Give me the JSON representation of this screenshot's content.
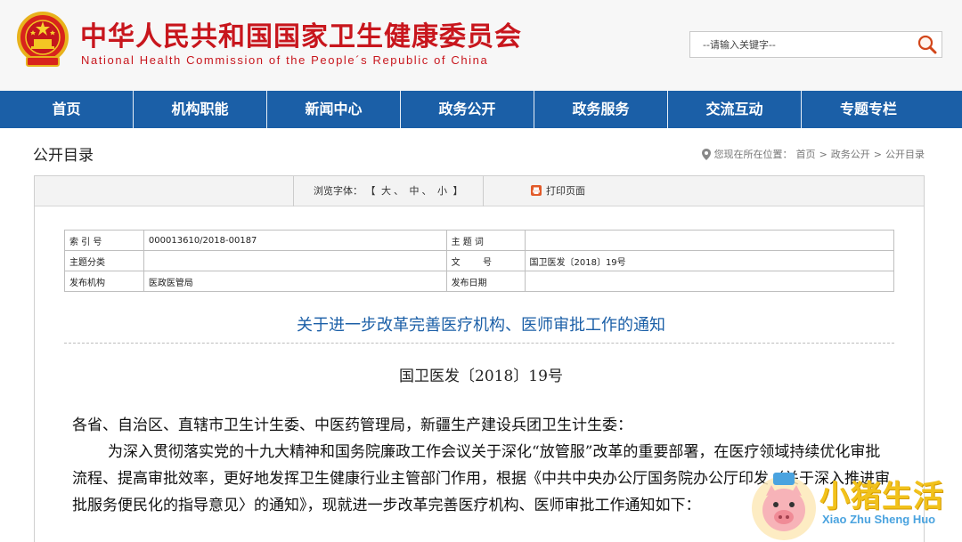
{
  "header": {
    "site_name_cn": "中华人民共和国国家卫生健康委员会",
    "site_name_en": "National Health Commission of the People´s Republic of China",
    "search_placeholder": "--请输入关键字--"
  },
  "nav": {
    "items": [
      "首页",
      "机构职能",
      "新闻中心",
      "政务公开",
      "政务服务",
      "交流互动",
      "专题专栏"
    ]
  },
  "section": {
    "title": "公开目录",
    "breadcrumb_prefix": "您现在所在位置：",
    "breadcrumb": [
      "首页",
      "政务公开",
      "公开目录"
    ],
    "breadcrumb_sep": ">"
  },
  "toolbar": {
    "font_label": "浏览字体：",
    "bracket_open": "【",
    "bracket_close": "】",
    "sizes": [
      "大",
      "中",
      "小"
    ],
    "size_sep": "、",
    "print_label": "打印页面"
  },
  "meta": {
    "rows": [
      {
        "k1": "索 引 号",
        "v1": "000013610/2018-00187",
        "k2": "主 题 词",
        "v2": ""
      },
      {
        "k1": "主题分类",
        "v1": "",
        "k2": "文        号",
        "v2": "国卫医发〔2018〕19号"
      },
      {
        "k1": "发布机构",
        "v1": "医政医管局",
        "k2": "发布日期",
        "v2": ""
      }
    ]
  },
  "document": {
    "title": "关于进一步改革完善医疗机构、医师审批工作的通知",
    "number": "国卫医发〔2018〕19号",
    "salutation": "各省、自治区、直辖市卫生计生委、中医药管理局，新疆生产建设兵团卫生计生委：",
    "paragraph": "为深入贯彻落实党的十九大精神和国务院廉政工作会议关于深化“放管服”改革的重要部署，在医疗领域持续优化审批流程、提高审批效率，更好地发挥卫生健康行业主管部门作用，根据《中共中央办公厅国务院办公厅印发〈关于深入推进审批服务便民化的指导意见〉的通知》，现就进一步改革完善医疗机构、医师审批工作通知如下："
  },
  "watermark": {
    "text_cn": "小猪生活",
    "text_en": "Xiao Zhu Sheng Huo"
  },
  "colors": {
    "brand_red": "#c8161d",
    "nav_blue": "#1b5fa7",
    "watermark_yellow": "#f2c21b",
    "watermark_blue": "#4aa3df"
  }
}
